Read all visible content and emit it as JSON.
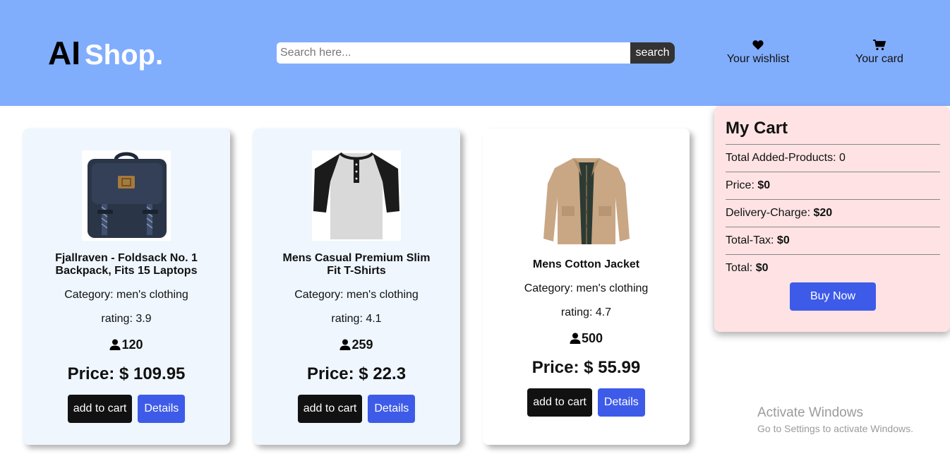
{
  "header": {
    "logo_ai": "AI",
    "logo_shop": "Shop.",
    "search_placeholder": "Search here...",
    "search_button": "search",
    "wishlist_label": "Your wishlist",
    "wishlist_icon": "heart-icon",
    "cart_label": "Your card",
    "cart_icon": "shopping-cart-icon",
    "bg_color": "#81adfd"
  },
  "products": [
    {
      "title": "Fjallraven - Foldsack No. 1 Backpack, Fits 15 Laptops",
      "category": "Category: men's clothing",
      "rating": "rating: 3.9",
      "reviews": "120",
      "price": "Price: $ 109.95",
      "add_label": "add to cart",
      "details_label": "Details"
    },
    {
      "title": "Mens Casual Premium Slim Fit T-Shirts",
      "category": "Category: men's clothing",
      "rating": "rating: 4.1",
      "reviews": "259",
      "price": "Price: $ 22.3",
      "add_label": "add to cart",
      "details_label": "Details"
    },
    {
      "title": "Mens Cotton Jacket",
      "category": "Category: men's clothing",
      "rating": "rating: 4.7",
      "reviews": "500",
      "price": "Price: $ 55.99",
      "add_label": "add to cart",
      "details_label": "Details"
    }
  ],
  "cart": {
    "title": "My Cart",
    "rows": [
      {
        "label": "Total Added-Products: ",
        "value": "0"
      },
      {
        "label": "Price: ",
        "value": "$0"
      },
      {
        "label": "Delivery-Charge: ",
        "value": "$20"
      },
      {
        "label": "Total-Tax: ",
        "value": "$0"
      },
      {
        "label": "Total: ",
        "value": "$0"
      }
    ],
    "buy_label": "Buy Now"
  },
  "watermark": {
    "line1": "Activate Windows",
    "line2": "Go to Settings to activate Windows."
  },
  "colors": {
    "accent_blue": "#3d5be8",
    "card_bg": "#eff6fe",
    "cart_bg": "#ffe3e4"
  }
}
